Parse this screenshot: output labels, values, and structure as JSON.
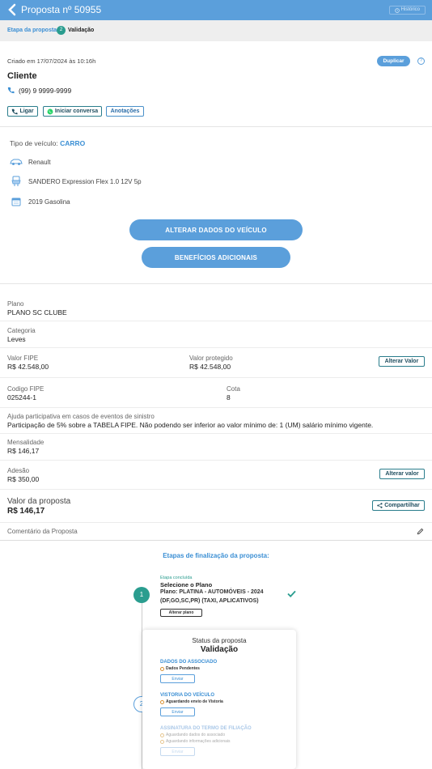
{
  "header": {
    "title": "Proposta nº 50955",
    "history_label": "Histórico"
  },
  "stage": {
    "label": "Etapa da proposta:",
    "number": "2",
    "value": "Validação"
  },
  "client": {
    "created": "Criado em 17/07/2024 às 10:16h",
    "duplicate_label": "Duplicar",
    "help_glyph": "?",
    "heading": "Cliente",
    "phone": "(99) 9 9999-9999",
    "call_label": "Ligar",
    "chat_label": "Iniciar conversa",
    "notes_label": "Anotações"
  },
  "vehicle": {
    "type_label": "Tipo de veículo:",
    "type_value": "CARRO",
    "brand": "Renault",
    "model": "SANDERO Expression Flex 1.0 12V 5p",
    "year": "2019 Gasolina",
    "change_button": "ALTERAR DADOS DO VEÍCULO",
    "benefits_button": "BENEFÍCIOS ADICIONAIS"
  },
  "details": {
    "plan_label": "Plano",
    "plan_value": "PLANO SC CLUBE",
    "category_label": "Categoria",
    "category_value": "Leves",
    "fipe_value_label": "Valor FIPE",
    "fipe_value": "R$ 42.548,00",
    "protected_label": "Valor protegido",
    "protected_value": "R$ 42.548,00",
    "change_value_button": "Alterar Valor",
    "fipe_code_label": "Codigo FIPE",
    "fipe_code": "025244-1",
    "quota_label": "Cota",
    "quota_value": "8",
    "participation_label": "Ajuda participativa em casos de eventos de sinistro",
    "participation_value": "Participação de 5% sobre a TABELA FIPE. Não podendo ser inferior ao valor mínimo de: 1 (UM) salário mínimo vigente.",
    "monthly_label": "Mensalidade",
    "monthly_value": "R$ 146,17",
    "adhesion_label": "Adesão",
    "adhesion_value": "R$ 350,00",
    "change_value_button2": "Alterar valor",
    "proposal_value_label": "Valor da proposta",
    "proposal_value": "R$ 146,17",
    "share_button": "Compartilhar",
    "comment_label": "Comentário da Proposta"
  },
  "steps": {
    "title": "Etapas de finalização da proposta:",
    "step1": {
      "number": "1",
      "status": "Etapa concluída",
      "title": "Selecione o Plano",
      "plan_line1": "Plano: PLATINA - AUTOMÓVEIS - 2024",
      "plan_line2": "(DF,GO,SC,PR) (TAXI, APLICATIVOS)",
      "button": "Alterar plano"
    },
    "step2": {
      "number": "2",
      "card_title": "Status da proposta",
      "card_value": "Validação",
      "associate_head": "DADOS DO ASSOCIADO",
      "associate_item": "Dados Pendentes",
      "associate_btn": "Enviar",
      "inspection_head": "VISTORIA DO VEÍCULO",
      "inspection_item": "Aguardando envio de Vistoria",
      "inspection_btn": "Enviar",
      "term_head": "ASSINATURA DO TERMO DE FILIAÇÃO",
      "term_item1": "Aguardando dados do associado",
      "term_item2": "Aguardando informações adicionais",
      "term_btn": "Enviar"
    }
  },
  "colors": {
    "primary": "#5b9fdb",
    "accent": "#3b8fd4",
    "success": "#2a9d8f"
  }
}
